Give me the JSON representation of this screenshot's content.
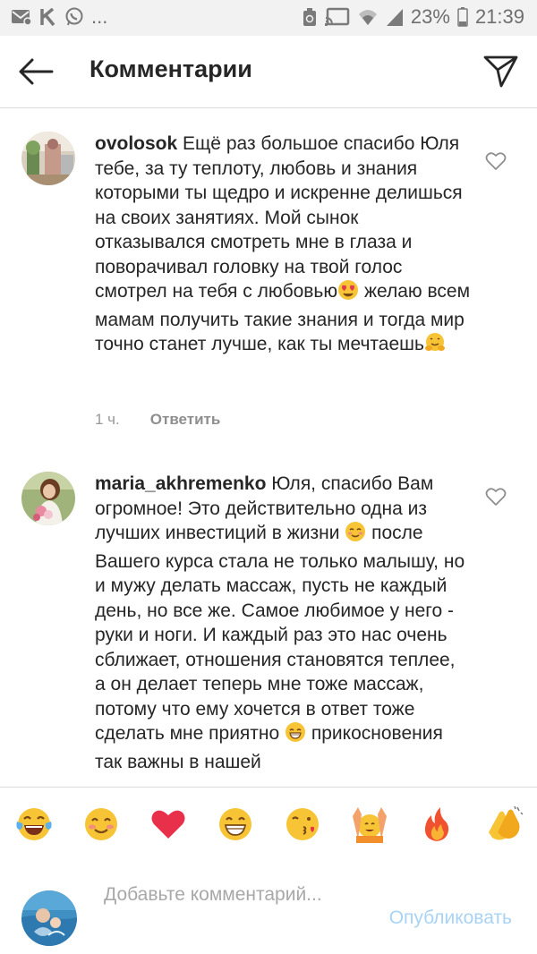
{
  "status_bar": {
    "left_icons": [
      "mail-icon",
      "k-icon",
      "whatsapp-icon"
    ],
    "more": "...",
    "battery_percent": "23%",
    "time": "21:39"
  },
  "header": {
    "title": "Комментарии"
  },
  "comments": [
    {
      "username": "ovolosok",
      "text_parts": [
        " Ещё раз большое спасибо Юля тебе, за ту теплоту, любовь и знания которыми ты щедро и искренне делишься на своих занятиях. Мой сынок отказывался смотреть мне в глаза и поворачивал головку на твой голос смотрел на тебя с любовью",
        " желаю всем мамам получить такие знания и тогда мир точно станет лучше, как ты мечтаешь"
      ],
      "emojis": [
        "heart-eyes-emoji",
        "hugging-emoji"
      ],
      "time": "1 ч.",
      "reply_label": "Ответить"
    },
    {
      "username": "maria_akhremenko",
      "text_parts": [
        " Юля, спасибо Вам огромное! Это действительно одна из лучших инвестиций в жизни ",
        " после Вашего курса стала не только малышу, но и мужу делать массаж, пусть не каждый день, но все же. Самое любимое у него - руки и ноги. И каждый раз это нас очень сближает, отношения становятся теплее, а он делает теперь мне тоже массаж, потому что ему хочется в ответ тоже сделать мне приятно ",
        " прикосновения так важны в нашей"
      ],
      "emojis": [
        "smiling-blush-emoji",
        "grinning-emoji"
      ]
    }
  ],
  "emoji_bar": [
    "tears-of-joy-emoji",
    "smiling-blush-emoji",
    "red-heart-emoji",
    "grinning-emoji",
    "kissing-emoji",
    "raising-hands-emoji",
    "fire-emoji",
    "clapping-hands-emoji"
  ],
  "composer": {
    "placeholder": "Добавьте комментарий...",
    "publish_label": "Опубликовать"
  },
  "colors": {
    "text": "#262626",
    "secondary": "#999999",
    "divider": "#dbdbdb",
    "publish_disabled": "#a9d3f5",
    "status_bg": "#f2f2f2"
  }
}
